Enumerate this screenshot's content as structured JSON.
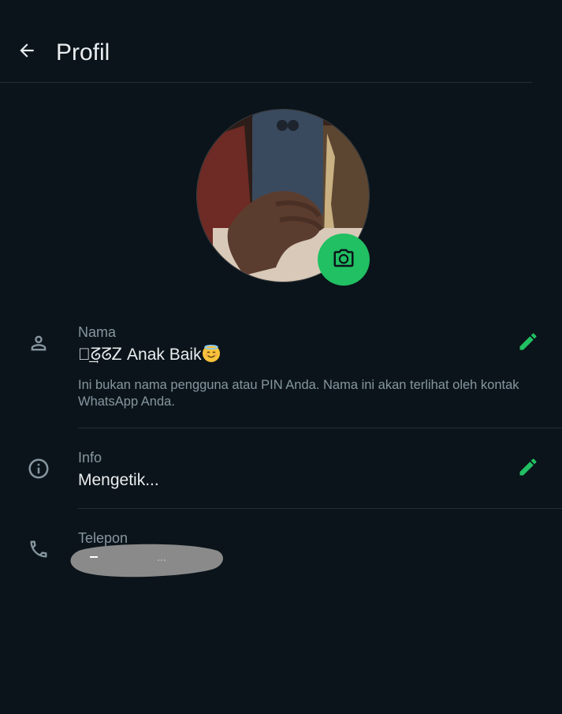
{
  "header": {
    "title": "Profil"
  },
  "profile": {
    "name": {
      "label": "Nama",
      "value": "ᡶ͢ᘔᘔᏃ Anak Baik",
      "hint": "Ini bukan nama pengguna atau PIN Anda. Nama ini akan terlihat oleh kontak WhatsApp Anda."
    },
    "info": {
      "label": "Info",
      "value": "Mengetik..."
    },
    "phone": {
      "label": "Telepon"
    }
  },
  "colors": {
    "accent": "#21c063",
    "background": "#0b141a",
    "secondary_text": "#8696a0"
  },
  "icons": {
    "back": "arrow-left-icon",
    "camera": "camera-icon",
    "name": "person-icon",
    "info": "info-icon",
    "phone": "phone-icon",
    "edit": "pencil-icon"
  }
}
